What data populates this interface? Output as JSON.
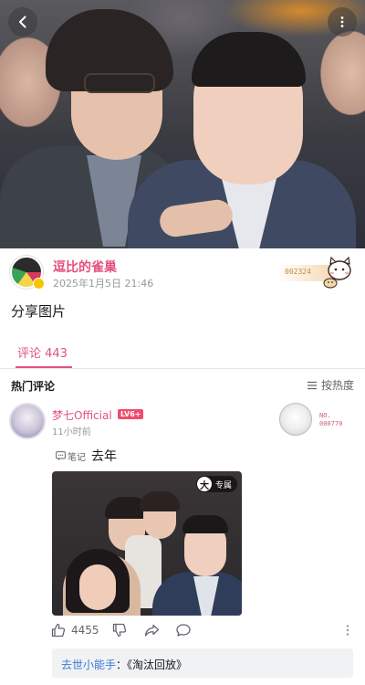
{
  "nav": {
    "back_icon": "chevron-left-icon",
    "more_icon": "more-vertical-icon"
  },
  "post": {
    "author_name": "逗比的雀巢",
    "time": "2025年1月5日 21:46",
    "fan_badge_number": "002324",
    "text": "分享图片"
  },
  "tabs": {
    "comment_label": "评论 443"
  },
  "comments_header": {
    "title": "热门评论",
    "sort_label": "按热度"
  },
  "comment": {
    "user": "梦七Official",
    "level": "LV6+",
    "time": "11小时前",
    "decoration_no": "NO.\n000770",
    "note_tag": "笔记",
    "text": "去年",
    "exclusive_badge_char": "大",
    "exclusive_label": "专属",
    "likes": "4455",
    "reply_user": "去世小能手",
    "reply_text": "《淘汰回放》"
  },
  "colors": {
    "accent": "#e3527d",
    "link": "#3a7bd5",
    "muted": "#9499a0"
  }
}
